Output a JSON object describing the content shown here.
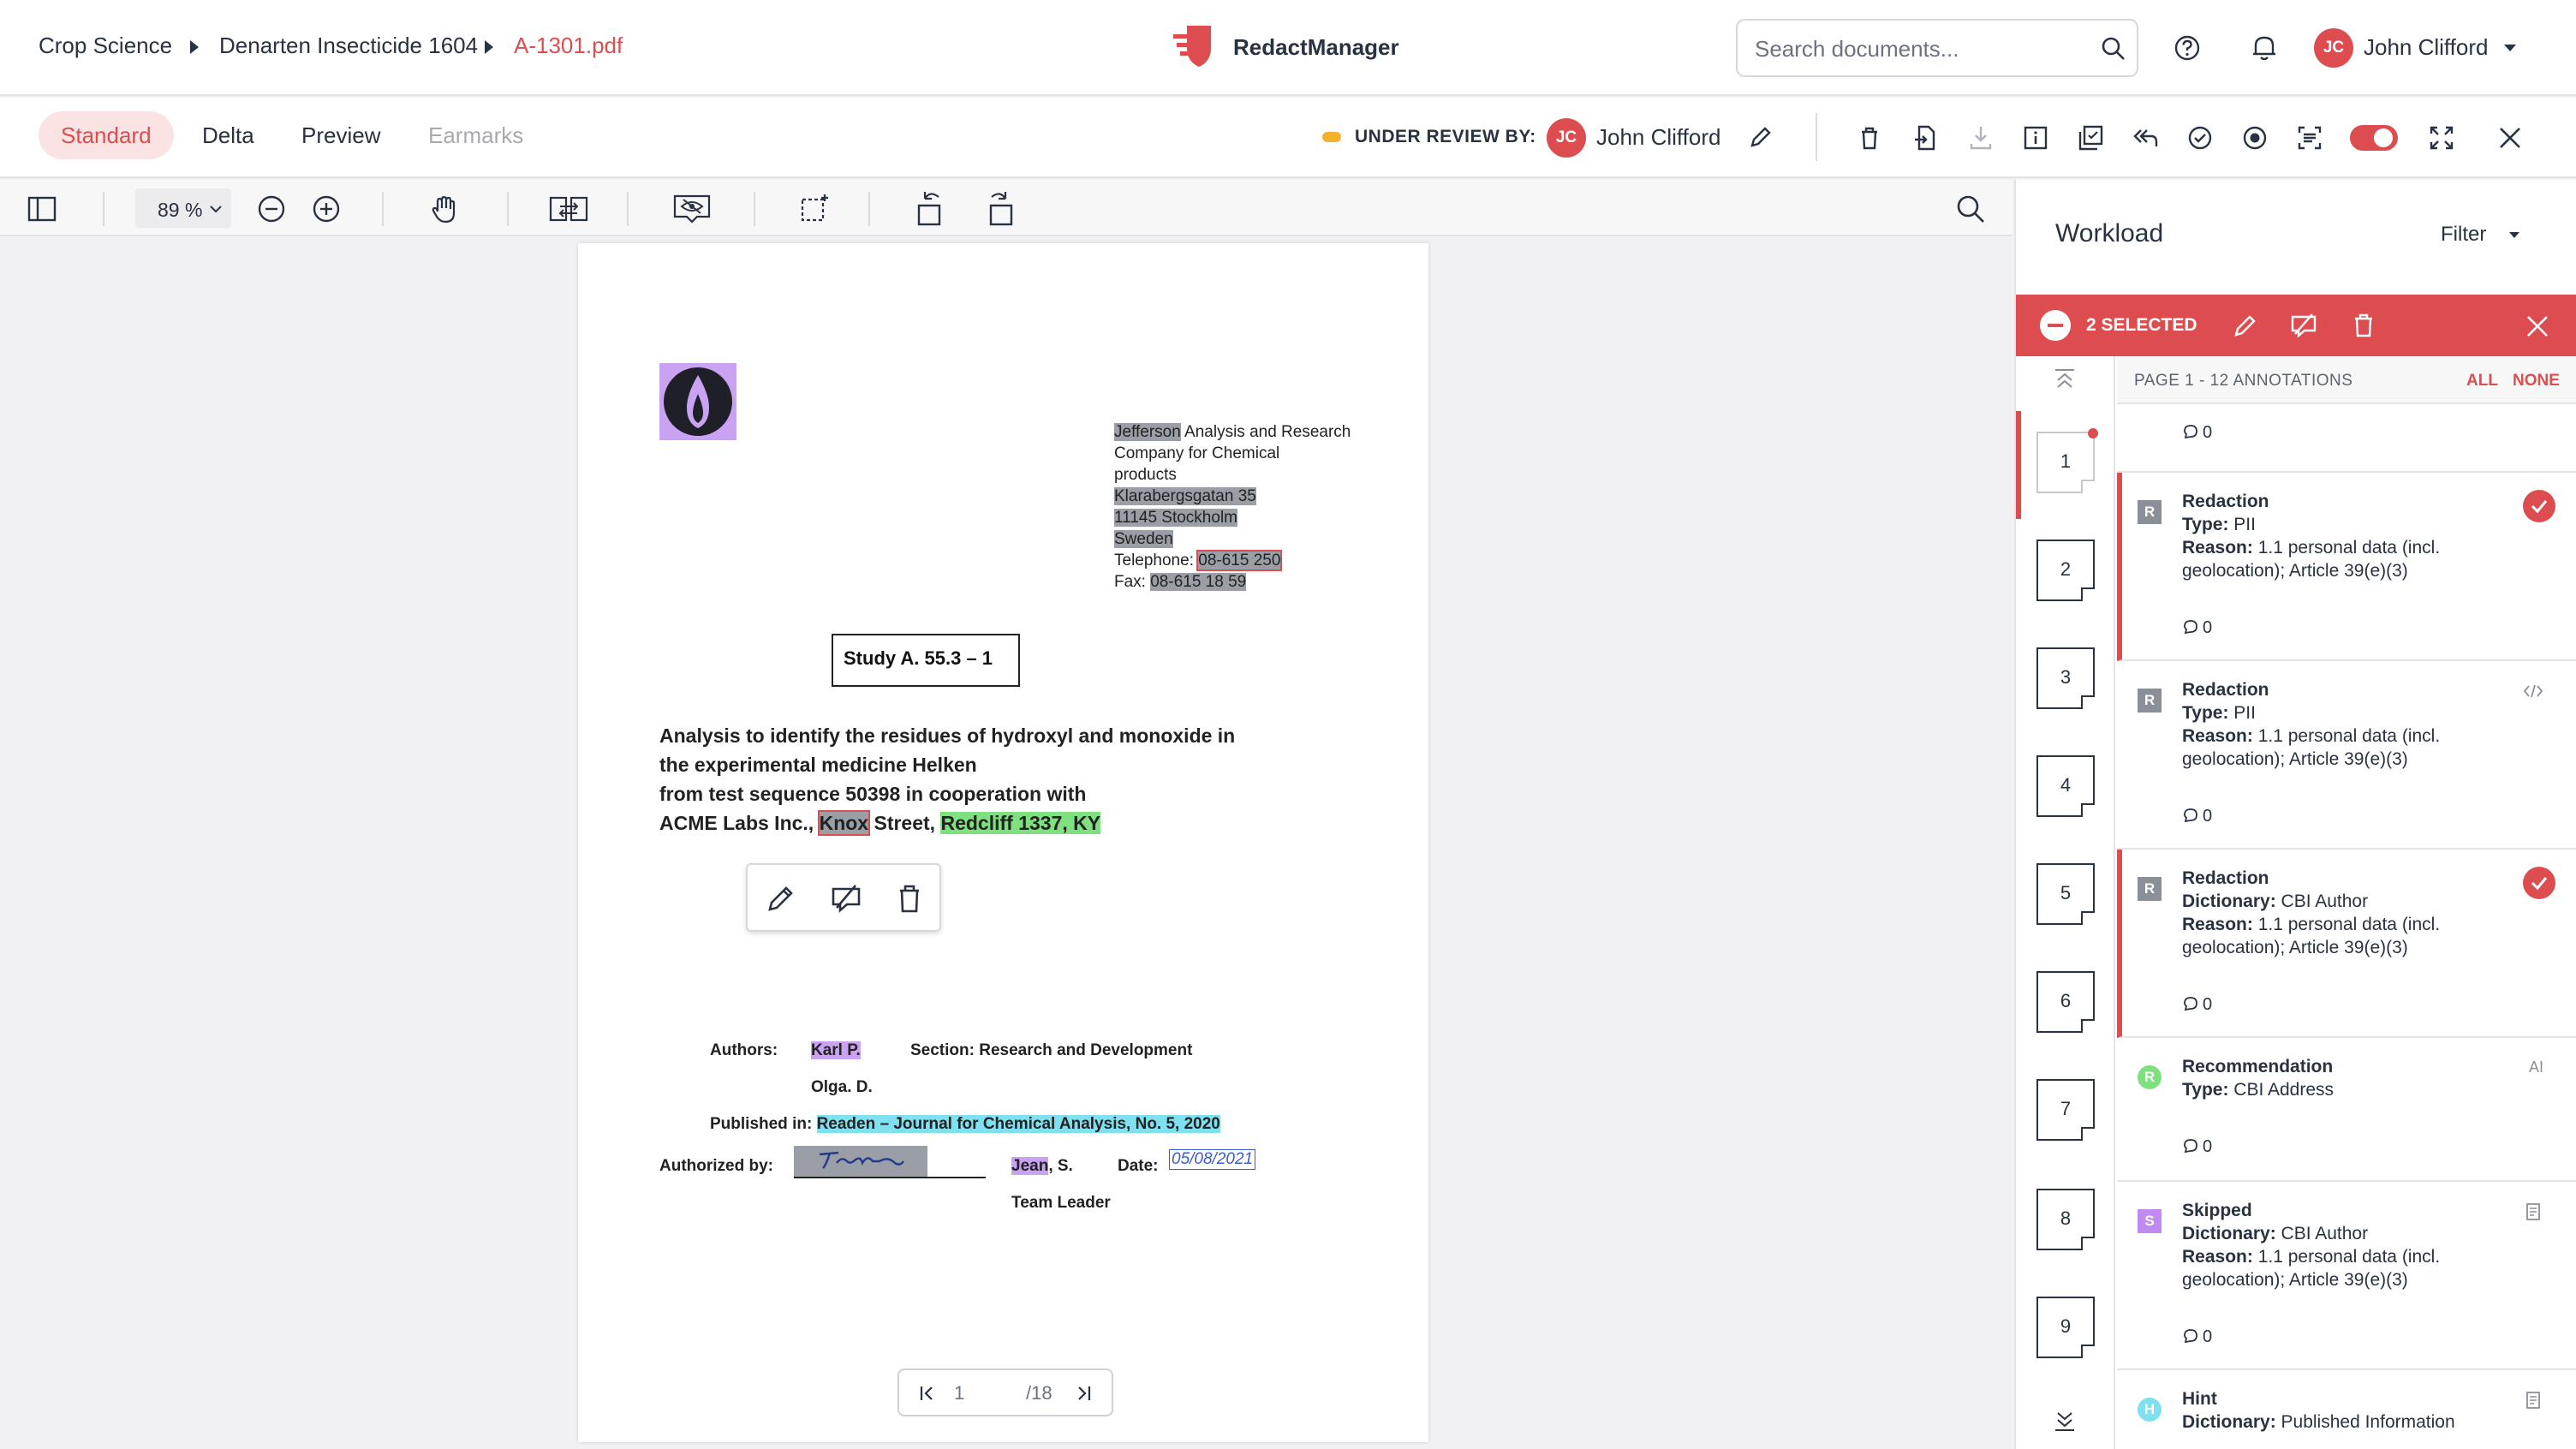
{
  "header": {
    "breadcrumb": [
      "Crop Science",
      "Denarten Insecticide 1604",
      "A-1301.pdf"
    ],
    "app_name": "RedactManager",
    "search_placeholder": "Search documents...",
    "user": {
      "initials": "JC",
      "name": "John Clifford"
    }
  },
  "viewbar": {
    "tabs": [
      {
        "label": "Standard",
        "state": "active"
      },
      {
        "label": "Delta",
        "state": "normal"
      },
      {
        "label": "Preview",
        "state": "normal"
      },
      {
        "label": "Earmarks",
        "state": "disabled"
      }
    ],
    "review_label": "UNDER REVIEW BY:",
    "reviewer": {
      "initials": "JC",
      "name": "John Clifford"
    },
    "toggle_on": true
  },
  "toolbar": {
    "zoom": "89 %"
  },
  "document": {
    "address": {
      "line1_hl": "Jefferson",
      "line1_rest": " Analysis and Research",
      "line2": "Company for Chemical",
      "line3": "products",
      "street": "Klarabergsgatan 35",
      "city": "11145 Stockholm",
      "country": "Sweden",
      "phone_label": "Telephone: ",
      "phone": "08-615 250",
      "fax_label": "Fax: ",
      "fax": "08-615 18 59"
    },
    "study": "Study A. 55.3 – 1",
    "title_lines": [
      "Analysis to identify the residues of hydroxyl and monoxide in",
      "the experimental medicine Helken",
      "from test sequence 50398 in cooperation with"
    ],
    "title_last_prefix": "ACME Labs Inc., ",
    "title_last_hl1": "Knox",
    "title_last_mid": " Street, ",
    "title_last_hl2": "Redcliff 1337, KY",
    "authors_label": "Authors:",
    "author1": "Karl P.",
    "author2": "Olga. D.",
    "section": "Section: Research and Development",
    "published_label": "Published in: ",
    "published": "Readen – Journal for Chemical Analysis, No. 5, 2020",
    "authorized_label": "Authorized by:",
    "signer_hl": "Jean",
    "signer_rest": ", S.",
    "signer_role": "Team Leader",
    "date_label": "Date:",
    "date_value": "05/08/2021",
    "page_current": "1",
    "page_total": "/18"
  },
  "workload": {
    "title": "Workload",
    "filter": "Filter",
    "selected": "2 SELECTED",
    "page_header": "PAGE 1 - 12 ANNOTATIONS",
    "all": "ALL",
    "none": "NONE",
    "top_comment": "0",
    "pages": [
      "1",
      "2",
      "3",
      "4",
      "5",
      "6",
      "7",
      "8",
      "9"
    ],
    "annotations": [
      {
        "badge": "R",
        "badge_color": "#8b8f98",
        "title": "Redaction",
        "k1": "Type:",
        "v1": " PII",
        "k2": "Reason:",
        "v2": " 1.1 personal data (incl. geolocation); Article 39(e)(3)",
        "comments": "0",
        "selected": true,
        "side": "check"
      },
      {
        "badge": "R",
        "badge_color": "#8b8f98",
        "title": "Redaction",
        "k1": "Type:",
        "v1": " PII",
        "k2": "Reason:",
        "v2": " 1.1 personal data (incl. geolocation); Article 39(e)(3)",
        "comments": "0",
        "selected": false,
        "side": "code"
      },
      {
        "badge": "R",
        "badge_color": "#8b8f98",
        "title": "Redaction",
        "k1": "Dictionary:",
        "v1": " CBI Author",
        "k2": "Reason:",
        "v2": " 1.1 personal data (incl. geolocation); Article 39(e)(3)",
        "comments": "0",
        "selected": true,
        "side": "check"
      },
      {
        "badge": "R",
        "badge_color": "#7ee07e",
        "title": "Recommendation",
        "k1": "Type:",
        "v1": " CBI Address",
        "k2": "",
        "v2": "",
        "comments": "0",
        "selected": false,
        "side": "AI"
      },
      {
        "badge": "S",
        "badge_color": "#c08af0",
        "title": "Skipped",
        "k1": "Dictionary:",
        "v1": " CBI Author",
        "k2": "Reason:",
        "v2": " 1.1 personal data (incl. geolocation); Article 39(e)(3)",
        "comments": "0",
        "selected": false,
        "side": "page"
      },
      {
        "badge": "H",
        "badge_color": "#7fe0f0",
        "title": "Hint",
        "k1": "Dictionary:",
        "v1": " Published Information",
        "k2": "",
        "v2": "",
        "comments": "",
        "selected": false,
        "side": "page"
      }
    ]
  }
}
